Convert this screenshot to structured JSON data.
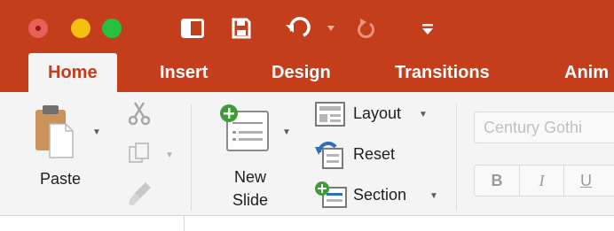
{
  "window": {
    "controls": [
      "close",
      "minimize",
      "maximize"
    ]
  },
  "quick_access_toolbar": {
    "icons": [
      "sidebar-icon",
      "save-icon",
      "undo-icon",
      "undo-dropdown-icon",
      "redo-icon",
      "customize-toolbar-icon"
    ]
  },
  "tabs": [
    {
      "label": "Home",
      "active": true
    },
    {
      "label": "Insert",
      "active": false
    },
    {
      "label": "Design",
      "active": false
    },
    {
      "label": "Transitions",
      "active": false
    },
    {
      "label": "Anim",
      "active": false
    }
  ],
  "clipboard": {
    "paste_label": "Paste",
    "tools": [
      "cut-icon",
      "copy-icon",
      "format-painter-icon"
    ]
  },
  "slides": {
    "new_slide_line1": "New",
    "new_slide_line2": "Slide",
    "layout_label": "Layout",
    "reset_label": "Reset",
    "section_label": "Section"
  },
  "font": {
    "font_name": "Century Gothi",
    "bold": "B",
    "italic": "I",
    "underline": "U"
  },
  "colors": {
    "accent": "#c43e1c",
    "ribbon_bg": "#f4f4f4"
  }
}
